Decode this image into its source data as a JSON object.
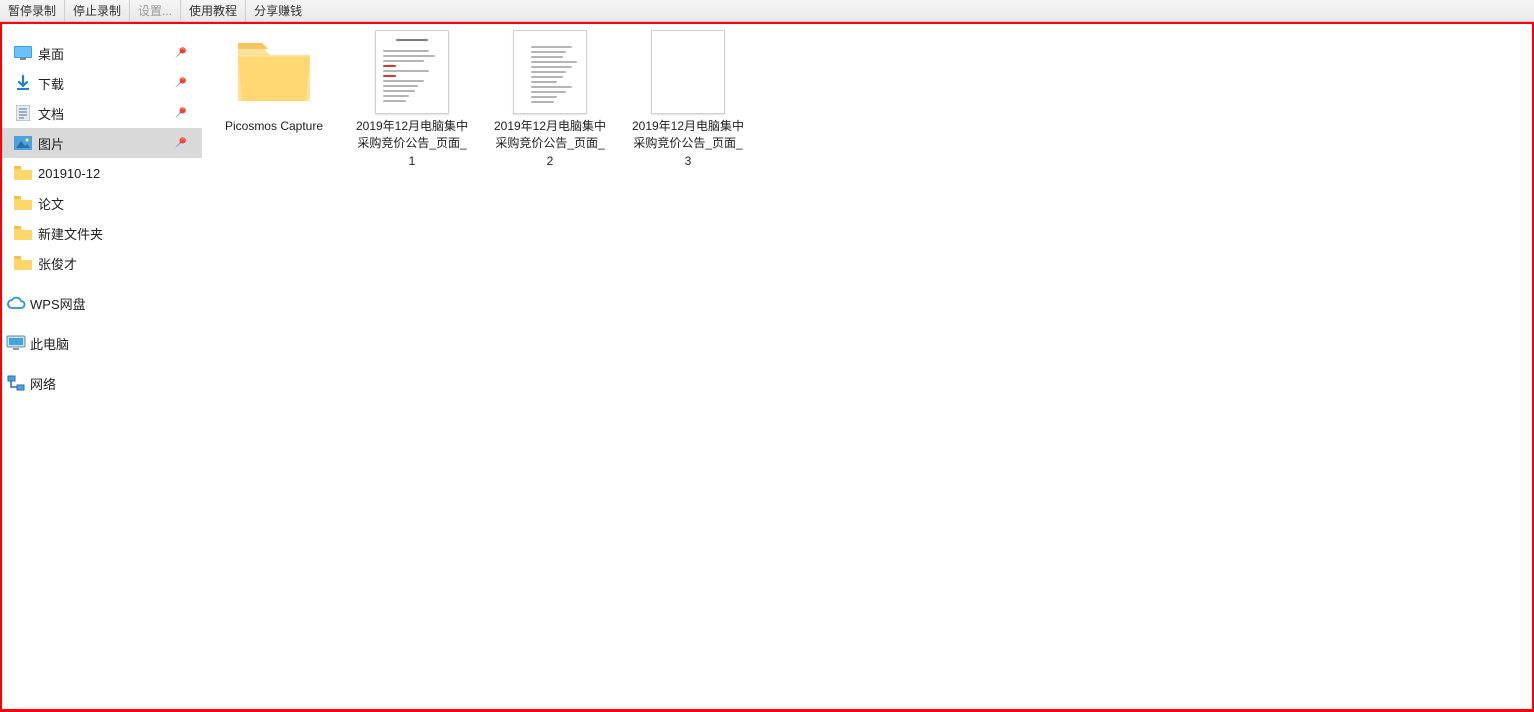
{
  "toolbar": {
    "pause_record": "暂停录制",
    "stop_record": "停止录制",
    "settings": "设置...",
    "tutorial": "使用教程",
    "share_earn": "分享赚钱"
  },
  "sidebar": {
    "quick_access": [
      {
        "label": "桌面",
        "icon": "desktop-icon",
        "pinned": true
      },
      {
        "label": "下载",
        "icon": "download-icon",
        "pinned": true
      },
      {
        "label": "文档",
        "icon": "document-icon",
        "pinned": true
      },
      {
        "label": "图片",
        "icon": "pictures-icon",
        "pinned": true,
        "selected": true
      },
      {
        "label": "201910-12",
        "icon": "folder-icon",
        "pinned": false
      },
      {
        "label": "论文",
        "icon": "folder-icon",
        "pinned": false
      },
      {
        "label": "新建文件夹",
        "icon": "folder-icon",
        "pinned": false
      },
      {
        "label": "张俊才",
        "icon": "folder-icon",
        "pinned": false
      }
    ],
    "wps": "WPS网盘",
    "this_pc": "此电脑",
    "network": "网络"
  },
  "content": {
    "items": [
      {
        "type": "folder",
        "label": "Picosmos Capture"
      },
      {
        "type": "page",
        "label": "2019年12月电脑集中采购竞价公告_页面_1",
        "variant": "text"
      },
      {
        "type": "page",
        "label": "2019年12月电脑集中采购竞价公告_页面_2",
        "variant": "text"
      },
      {
        "type": "page",
        "label": "2019年12月电脑集中采购竞价公告_页面_3",
        "variant": "blank"
      }
    ]
  },
  "icons": {
    "desktop": "desktop-icon",
    "download": "download-icon",
    "document": "document-icon",
    "pictures": "pictures-icon",
    "folder": "folder-icon",
    "cloud": "cloud-icon",
    "pc": "pc-icon",
    "network": "network-icon",
    "pin": "pin-icon"
  }
}
